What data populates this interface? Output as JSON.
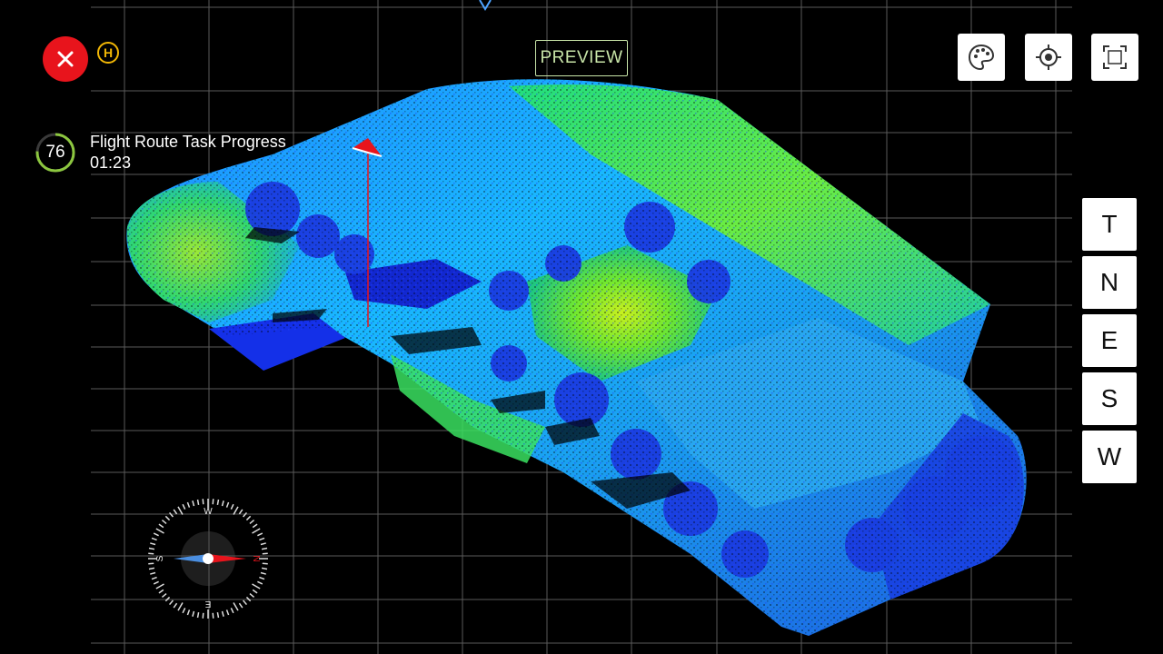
{
  "header": {
    "preview_label": "PREVIEW",
    "home_badge": "H"
  },
  "task_progress": {
    "percent": 76,
    "percent_label": "76",
    "title": "Flight Route Task Progress",
    "time": "01:23",
    "ring_color": "#8cc63f"
  },
  "toolbar": {
    "color_mode_icon": "palette-icon",
    "locate_icon": "locate-icon",
    "fit_view_icon": "fit-view-icon"
  },
  "view_controls": [
    {
      "label": "T"
    },
    {
      "label": "N"
    },
    {
      "label": "E"
    },
    {
      "label": "S"
    },
    {
      "label": "W"
    }
  ],
  "compass": {
    "top": "W",
    "right": "N",
    "bottom": "E",
    "left": "S"
  },
  "colors": {
    "close": "#e8141c",
    "accent": "#c8e5a8",
    "home": "#f2b705"
  }
}
